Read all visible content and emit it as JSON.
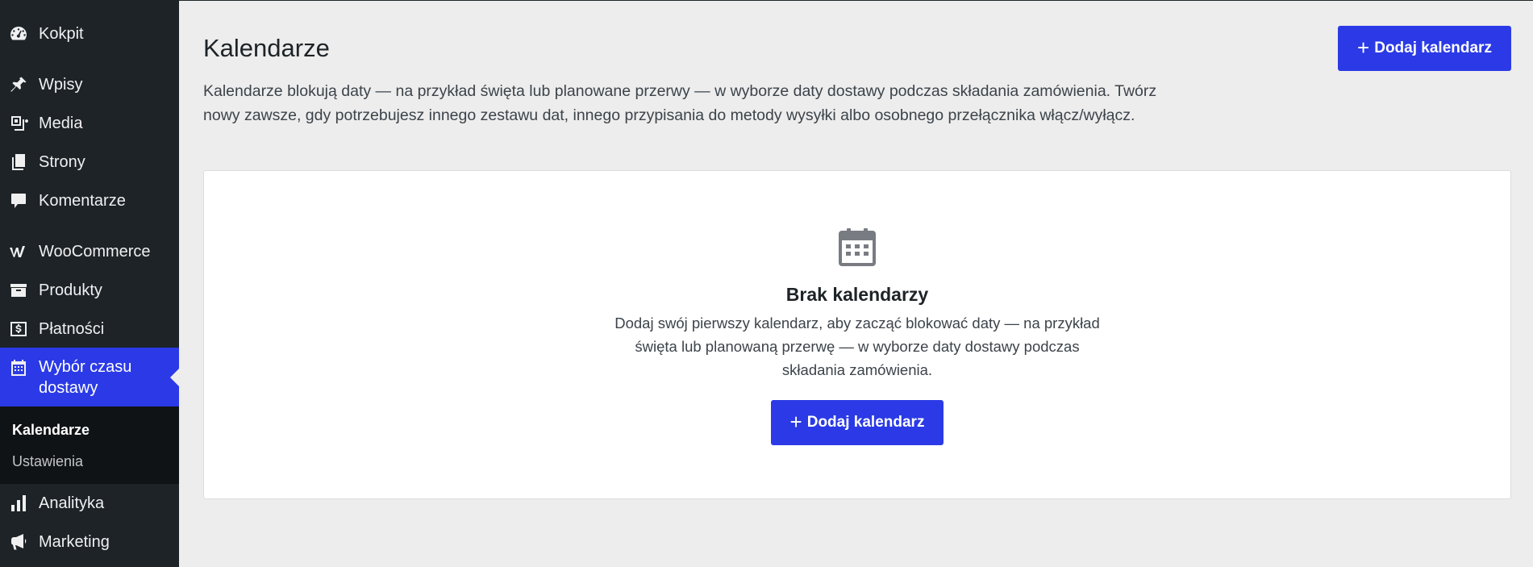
{
  "sidebar": {
    "items": [
      {
        "label": "Kokpit",
        "icon": "dashboard-icon"
      },
      {
        "label": "Wpisy",
        "icon": "pin-icon"
      },
      {
        "label": "Media",
        "icon": "media-icon"
      },
      {
        "label": "Strony",
        "icon": "pages-icon"
      },
      {
        "label": "Komentarze",
        "icon": "comment-icon"
      },
      {
        "label": "WooCommerce",
        "icon": "woocommerce-icon"
      },
      {
        "label": "Produkty",
        "icon": "archive-icon"
      },
      {
        "label": "Płatności",
        "icon": "payments-icon"
      },
      {
        "label": "Wybór czasu dostawy",
        "icon": "calendar-icon"
      },
      {
        "label": "Analityka",
        "icon": "chart-bar-icon"
      },
      {
        "label": "Marketing",
        "icon": "megaphone-icon"
      }
    ],
    "submenu": [
      {
        "label": "Kalendarze"
      },
      {
        "label": "Ustawienia"
      }
    ]
  },
  "main": {
    "title": "Kalendarze",
    "add_button_label": "Dodaj kalendarz",
    "intro": "Kalendarze blokują daty — na przykład święta lub planowane przerwy — w wyborze daty dostawy podczas składania zamówienia. Twórz nowy zawsze, gdy potrzebujesz innego zestawu dat, innego przypisania do metody wysyłki albo osobnego przełącznika włącz/wyłącz.",
    "empty_state": {
      "icon": "calendar-icon",
      "title": "Brak kalendarzy",
      "description": "Dodaj swój pierwszy kalendarz, aby zacząć blokować daty — na przykład święta lub planowaną przerwę — w wyborze daty dostawy podczas składania zamówienia.",
      "button_label": "Dodaj kalendarz"
    }
  },
  "colors": {
    "accent": "#2b3ae6",
    "sidebar_bg": "#1d2327",
    "submenu_bg": "#101316",
    "page_bg": "#ededed"
  }
}
